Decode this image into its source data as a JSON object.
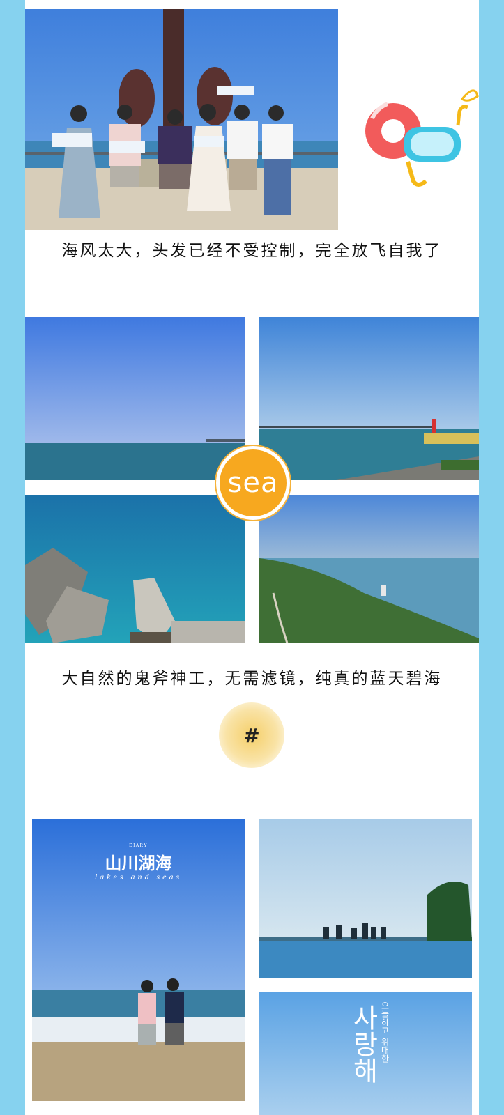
{
  "captions": {
    "first": "海风太大，头发已经不受控制，完全放飞自我了",
    "second": "大自然的鬼斧神工，无需滤镜，纯真的蓝天碧海"
  },
  "badges": {
    "sea": "sea",
    "hash": "#"
  },
  "posters": {
    "diary": "DIARY",
    "title": "山川湖海",
    "subtitle": "lakes and seas",
    "korean_title": "사랑해",
    "korean_side": "오늘하고 위대한"
  },
  "icons": {
    "float": "swim-ring-icon",
    "mask": "snorkel-mask-icon"
  }
}
